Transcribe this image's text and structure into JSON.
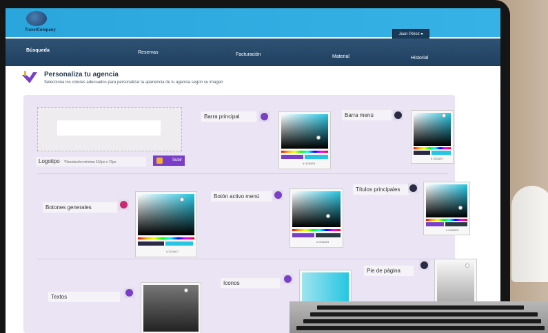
{
  "brand": {
    "name": "TravelCompany"
  },
  "user": {
    "name": "Jean Pérez"
  },
  "nav": [
    {
      "label": "Búsqueda"
    },
    {
      "label": "Reservas"
    },
    {
      "label": "Facturación"
    },
    {
      "label": "Material"
    },
    {
      "label": "Historial"
    }
  ],
  "page": {
    "title": "Personaliza tu agencia",
    "subtitle": "Selecciona los colores adecuados para personalizar la apariencia de tu agencia según su imagen"
  },
  "logo": {
    "label": "Logotipo",
    "hint": "*Resolución mínima 310px x 70px",
    "upload_label": "Subir"
  },
  "colors": {
    "barra_principal": {
      "label": "Barra principal",
      "color": "#7a3ec8",
      "hex": "# 0CB4E5"
    },
    "barra_menu": {
      "label": "Barra menú",
      "color": "#2a2a45",
      "hex": "# 32DAE7"
    },
    "botones_generales": {
      "label": "Botones generales",
      "color": "#c82a72",
      "hex": "# 32DAE7"
    },
    "boton_activo_menu": {
      "label": "Botón activo menú",
      "color": "#7a3ec8",
      "hex": "# 0CB4E5"
    },
    "titulos_principales": {
      "label": "Títulos principales",
      "color": "#2a2a45",
      "hex": "# 0CB4E5"
    },
    "textos": {
      "label": "Textos",
      "color": "#7a3ec8"
    },
    "iconos": {
      "label": "Iconos",
      "color": "#7a3ec8"
    },
    "pie_de_pagina": {
      "label": "Pie de página",
      "color": "#2a2a45"
    }
  },
  "accent": "#7a3ec8",
  "picker_preview_color": "#26c6e2"
}
